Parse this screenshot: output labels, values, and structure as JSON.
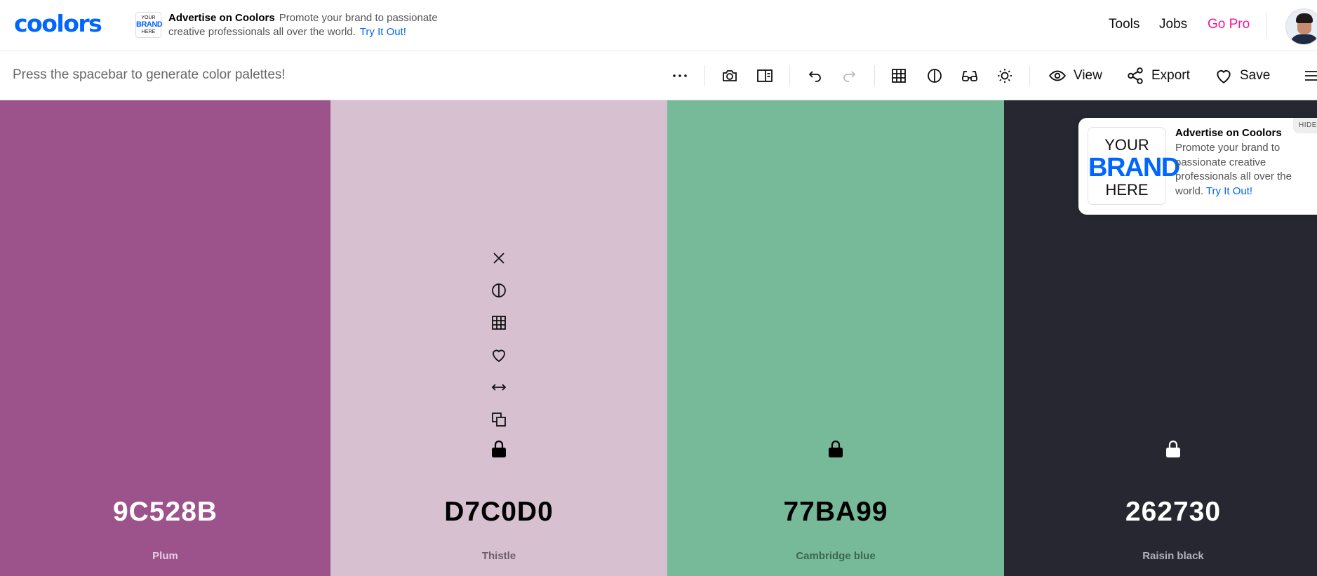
{
  "header": {
    "logo": "coolors",
    "ad": {
      "logo_your": "YOUR",
      "logo_brand": "BRAND",
      "logo_here": "HERE",
      "title": "Advertise on Coolors",
      "text": "Promote your brand to passionate creative professionals all over the world.",
      "cta": "Try It Out!"
    },
    "nav": {
      "tools": "Tools",
      "jobs": "Jobs",
      "pro": "Go Pro"
    }
  },
  "toolbar": {
    "hint": "Press the spacebar to generate color palettes!",
    "icons": [
      "more-icon",
      "camera-icon",
      "split-view-icon",
      "undo-icon",
      "redo-icon",
      "grid-icon",
      "contrast-icon",
      "glasses-icon",
      "brightness-icon"
    ],
    "view_label": "View",
    "export_label": "Export",
    "save_label": "Save"
  },
  "palette": {
    "colors": [
      {
        "hex": "9C528B",
        "name": "Plum",
        "bg": "#9C528B",
        "text_color": "#ffffff",
        "name_color": "#e8cde2"
      },
      {
        "hex": "D7C0D0",
        "name": "Thistle",
        "bg": "#D7C0D0",
        "text_color": "#000000",
        "name_color": "#6e5d68"
      },
      {
        "hex": "77BA99",
        "name": "Cambridge blue",
        "bg": "#77BA99",
        "text_color": "#000000",
        "name_color": "#3e6652"
      },
      {
        "hex": "262730",
        "name": "Raisin black",
        "bg": "#262730",
        "text_color": "#ffffff",
        "name_color": "#b0b1ba"
      }
    ],
    "hover_icons": [
      "close-icon",
      "contrast-icon",
      "grid-icon",
      "heart-icon",
      "drag-icon",
      "copy-icon",
      "lock-icon"
    ]
  },
  "ad_card": {
    "logo_your": "YOUR",
    "logo_brand": "BRAND",
    "logo_here": "HERE",
    "title": "Advertise on Coolors",
    "text": "Promote your brand to passionate creative professionals all over the world.",
    "cta": "Try It Out!",
    "hide_label": "HIDE"
  }
}
